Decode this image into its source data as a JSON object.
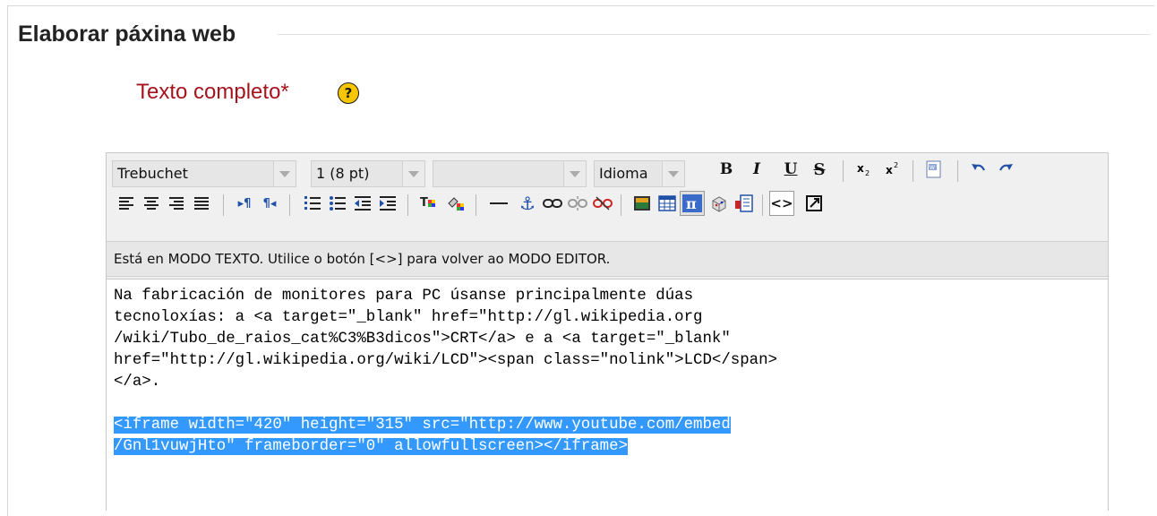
{
  "section": {
    "title": "Elaborar páxina web"
  },
  "field": {
    "label": "Texto completo*",
    "help_icon": "?"
  },
  "toolbar": {
    "font_family": "Trebuchet",
    "font_size": "1 (8 pt)",
    "format": "",
    "language": "Idioma",
    "bold": "B",
    "italic": "I",
    "underline": "U",
    "strikethrough": "S",
    "html_toggle": "<>",
    "icons": [
      "bold-icon",
      "italic-icon",
      "underline-icon",
      "strikethrough-icon",
      "subscript-icon",
      "superscript-icon",
      "paste-word-icon",
      "undo-icon",
      "redo-icon",
      "align-left-icon",
      "align-center-icon",
      "align-right-icon",
      "justify-icon",
      "ltr-icon",
      "rtl-icon",
      "ordered-list-icon",
      "unordered-list-icon",
      "outdent-icon",
      "indent-icon",
      "text-color-icon",
      "background-color-icon",
      "horizontal-rule-icon",
      "anchor-icon",
      "link-icon",
      "unlink-icon",
      "nolink-icon",
      "image-icon",
      "table-icon",
      "equation-icon",
      "emoticon-icon",
      "find-replace-icon",
      "html-mode-icon",
      "fullscreen-icon"
    ]
  },
  "status_message": "Está en MODO TEXTO. Utilice o botón [<>] para volver ao MODO EDITOR.",
  "editor_lines": [
    "Na fabricación de monitores para PC úsanse principalmente dúas",
    "tecnoloxías: a <a target=\"_blank\" href=\"http://gl.wikipedia.org",
    "/wiki/Tubo_de_raios_cat%C3%B3dicos\">CRT</a> e a <a target=\"_blank\"",
    "href=\"http://gl.wikipedia.org/wiki/LCD\"><span class=\"nolink\">LCD</span>",
    "</a>.",
    "",
    "<iframe width=\"420\" height=\"315\" src=\"http://www.youtube.com/embed",
    "/Gnl1vuwjHto\" frameborder=\"0\" allowfullscreen></iframe>"
  ],
  "colors": {
    "label_red": "#a5141c",
    "selection_blue": "#3399ff",
    "help_yellow": "#f7c600"
  }
}
